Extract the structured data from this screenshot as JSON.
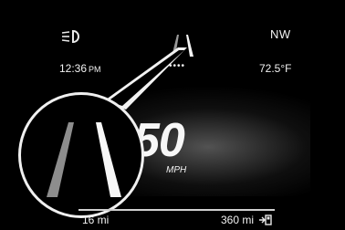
{
  "status": {
    "heading": "NW",
    "time": "12:36",
    "ampm": "PM",
    "temperature": "72.5°F",
    "indicator_dots": "••••"
  },
  "speedometer": {
    "speed": "50",
    "unit": "MPH"
  },
  "trip": {
    "distance": "16 mi",
    "range": "360 mi"
  },
  "icons": [
    "headlight-icon",
    "lane-assist-icon",
    "fuel-icon"
  ]
}
